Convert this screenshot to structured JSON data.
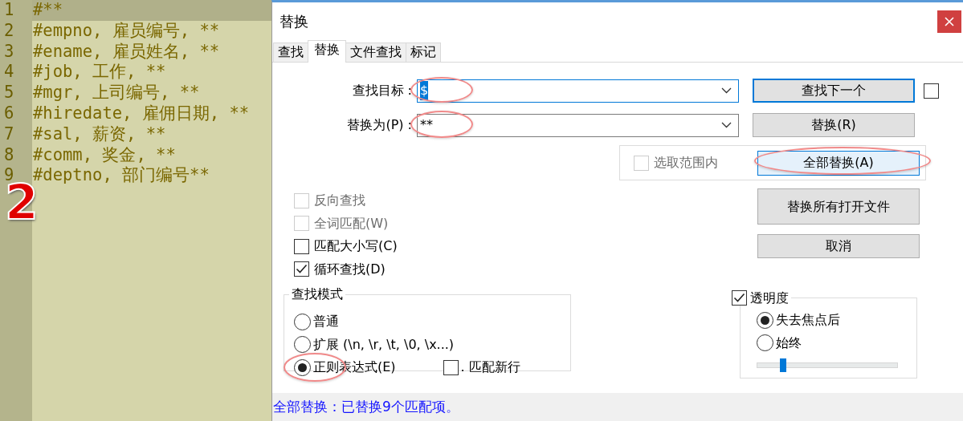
{
  "editor": {
    "lines": [
      {
        "number": "1",
        "text": "#**",
        "current": true
      },
      {
        "number": "2",
        "text": "#empno, 雇员编号, **",
        "current": false
      },
      {
        "number": "3",
        "text": "#ename, 雇员姓名, **",
        "current": false
      },
      {
        "number": "4",
        "text": "#job, 工作, **",
        "current": false
      },
      {
        "number": "5",
        "text": "#mgr, 上司编号, **",
        "current": false
      },
      {
        "number": "6",
        "text": "#hiredate, 雇佣日期, **",
        "current": false
      },
      {
        "number": "7",
        "text": "#sal, 薪资, **",
        "current": false
      },
      {
        "number": "8",
        "text": "#comm, 奖金, **",
        "current": false
      },
      {
        "number": "9",
        "text": "#deptno, 部门编号**",
        "current": false
      }
    ],
    "annotation": "2"
  },
  "dialog": {
    "title": "替换"
  },
  "tabs": [
    {
      "label": "查找",
      "selected": false
    },
    {
      "label": "替换",
      "selected": true
    },
    {
      "label": "文件查找",
      "selected": false
    },
    {
      "label": "标记",
      "selected": false
    }
  ],
  "fields": [
    {
      "label": "查找目标 :",
      "value": "$",
      "value_selected": true,
      "focused": true
    },
    {
      "label": "替换为(P) :",
      "value": "**",
      "value_selected": false,
      "focused": false
    }
  ],
  "buttons": [
    {
      "label": "查找下一个",
      "default": true,
      "hovered": false
    },
    {
      "label": "替换(R)",
      "default": false,
      "hovered": false
    },
    {
      "label": "全部替换(A)",
      "default": false,
      "hovered": true
    },
    {
      "label": "替换所有打开文件",
      "default": false,
      "hovered": false
    },
    {
      "label": "取消",
      "default": false,
      "hovered": false
    }
  ],
  "side_checkbox": {
    "checked": false
  },
  "in_selection": {
    "label": "选取范围内",
    "checked": false,
    "disabled": true
  },
  "options": [
    {
      "label": "反向查找",
      "checked": false,
      "disabled": true
    },
    {
      "label": "全词匹配(W)",
      "checked": false,
      "disabled": true
    },
    {
      "label": "匹配大小写(C)",
      "checked": false,
      "disabled": false
    },
    {
      "label": "循环查找(D)",
      "checked": true,
      "disabled": false
    }
  ],
  "search_mode": {
    "title": "查找模式",
    "modes": [
      {
        "label": "普通",
        "selected": false
      },
      {
        "label": "扩展 (\\n, \\r, \\t, \\0, \\x...)",
        "selected": false
      },
      {
        "label": "正则表达式(E)",
        "selected": true
      }
    ],
    "dot_newline": {
      "label": ". 匹配新行",
      "checked": false
    }
  },
  "transparency": {
    "label": "透明度",
    "checked": true,
    "modes": [
      {
        "label": "失去焦点后",
        "selected": true
      },
      {
        "label": "始终",
        "selected": false
      }
    ],
    "level": 0.18
  },
  "status_bar": "全部替换：已替换9个匹配项。"
}
